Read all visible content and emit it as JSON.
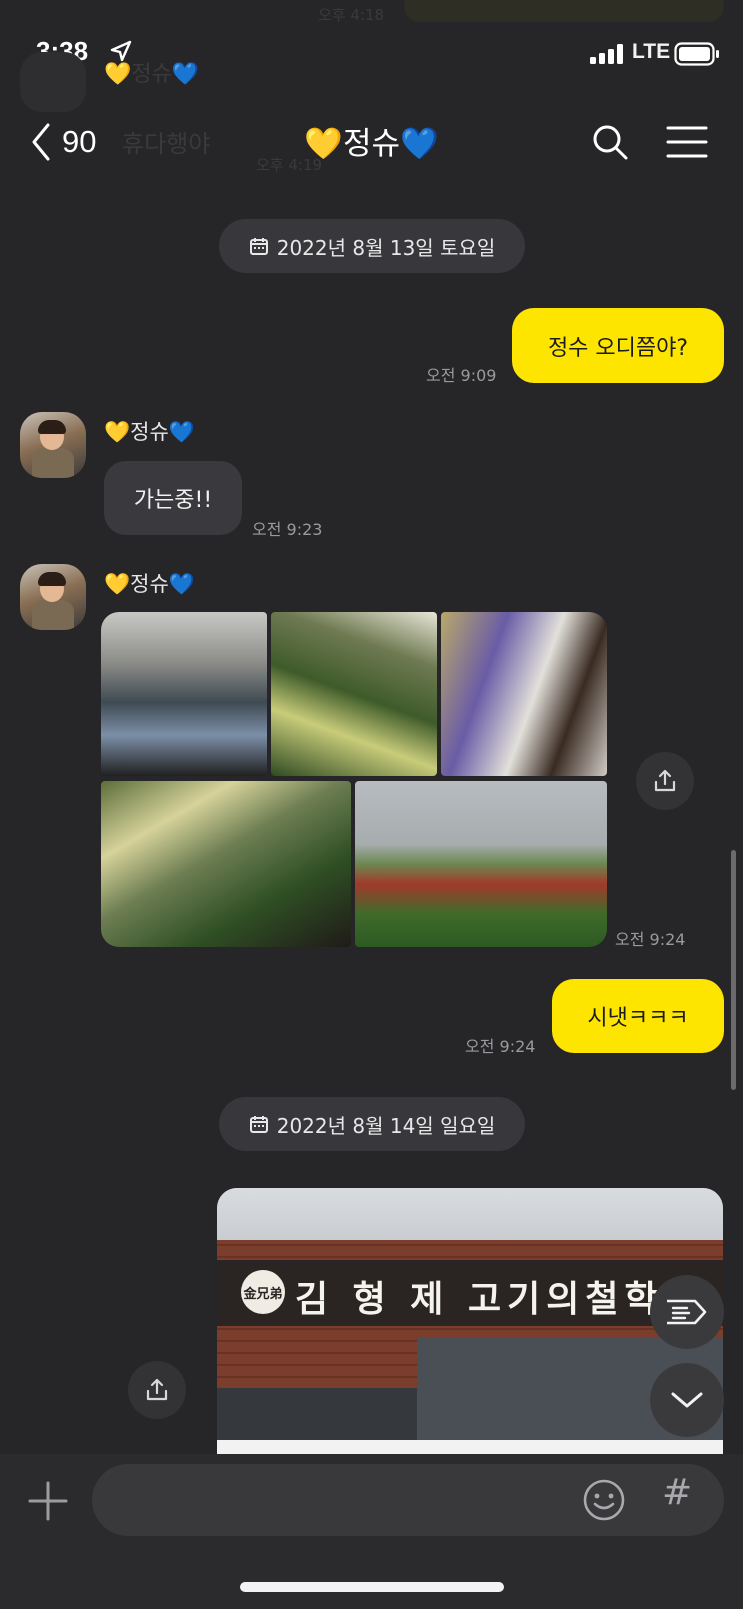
{
  "status_bar": {
    "time": "3:38",
    "network": "LTE"
  },
  "background_ghost": {
    "preview_time": "오후 4:18",
    "preview_name": "💛정슈💙",
    "preview_message": "휴다행야",
    "preview_time_2": "오후 4:19"
  },
  "header": {
    "back_count": "90",
    "title": "💛정슈💙"
  },
  "dates": {
    "first": "2022년 8월 13일 토요일",
    "second": "2022년 8월 14일 일요일"
  },
  "messages": [
    {
      "from": "me",
      "text": "정수 오디쯤야?",
      "time": "오전 9:09"
    },
    {
      "from": "them",
      "sender": "💛정슈💙",
      "text": "가는중!!",
      "time": "오전 9:23"
    },
    {
      "from": "them",
      "sender": "💛정슈💙",
      "type": "photos",
      "count": 5,
      "time": "오전 9:24"
    },
    {
      "from": "me",
      "text": "시냇ㅋㅋㅋ",
      "time": "오전 9:24"
    },
    {
      "from": "me",
      "type": "photo",
      "sign_text": "김 형 제 고기의철학",
      "logo_text": "金兄弟"
    }
  ],
  "input": {
    "placeholder": ""
  },
  "colors": {
    "background": "#262629",
    "my_bubble": "#fee500",
    "their_bubble": "#3a3a3e"
  }
}
